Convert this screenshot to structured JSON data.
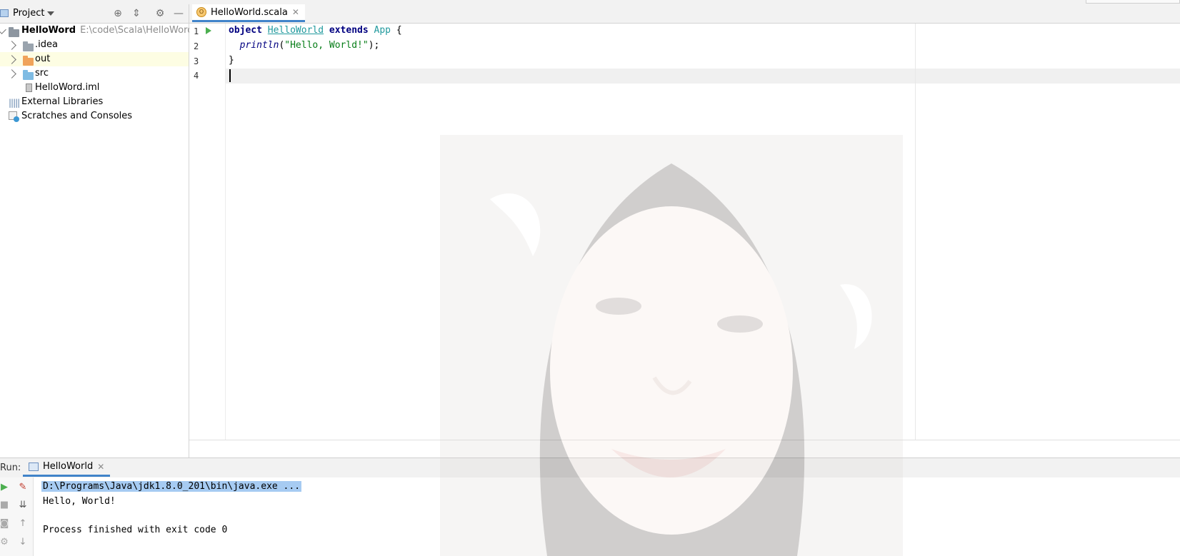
{
  "project_panel": {
    "title": "Project",
    "tree": [
      {
        "label": "HelloWord",
        "path": "E:\\code\\Scala\\HelloWord"
      },
      {
        "label": ".idea"
      },
      {
        "label": "out"
      },
      {
        "label": "src"
      },
      {
        "label": "HelloWord.iml"
      },
      {
        "label": "External Libraries"
      },
      {
        "label": "Scratches and Consoles"
      }
    ]
  },
  "editor": {
    "tab_label": "HelloWorld.scala",
    "line_numbers": [
      "1",
      "2",
      "3",
      "4"
    ],
    "code": {
      "line1_kw1": "object",
      "line1_cls": "HelloWorld",
      "line1_kw2": "extends",
      "line1_type": "App",
      "line1_brace": " {",
      "line2_fn": "println",
      "line2_open": "(",
      "line2_str": "\"Hello, World!\"",
      "line2_close": ");",
      "line3": "}"
    }
  },
  "run_panel": {
    "label": "Run:",
    "tab_label": "HelloWorld",
    "console_lines": [
      "D:\\Programs\\Java\\jdk1.8.0_201\\bin\\java.exe ...",
      "Hello, World!",
      "",
      "Process finished with exit code 0"
    ]
  },
  "colors": {
    "accent_tab_underline": "#4083c9",
    "keyword": "#000080",
    "class_name": "#20999d",
    "string": "#067d17",
    "selection": "#a6cbf2"
  }
}
